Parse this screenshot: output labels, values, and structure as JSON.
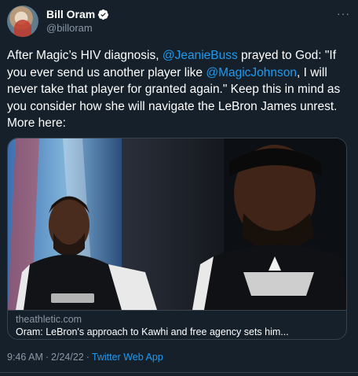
{
  "author": {
    "name": "Bill Oram",
    "handle": "@billoram",
    "verified": true
  },
  "tweet": {
    "text_parts": [
      {
        "type": "text",
        "value": "After Magic’s HIV diagnosis, "
      },
      {
        "type": "mention",
        "value": "@JeanieBuss"
      },
      {
        "type": "text",
        "value": " prayed to God: \"If you ever send us another player like "
      },
      {
        "type": "mention",
        "value": "@MagicJohnson"
      },
      {
        "type": "text",
        "value": ", I will never take that player for granted again.\" Keep this in mind as you consider how she will navigate the LeBron James unrest. More here:"
      }
    ]
  },
  "card": {
    "domain": "theathletic.com",
    "title": "Oram: LeBron's approach to Kawhi and free agency sets him..."
  },
  "footer": {
    "time": "9:46 AM",
    "date": "2/24/22",
    "separator": "·",
    "app": "Twitter Web App"
  },
  "colors": {
    "background": "#15202b",
    "accent": "#1d9bf0",
    "secondary_text": "#8b98a5",
    "border": "#38444d"
  },
  "icons": {
    "verified": "verified-badge-icon",
    "more": "more-options-icon"
  }
}
